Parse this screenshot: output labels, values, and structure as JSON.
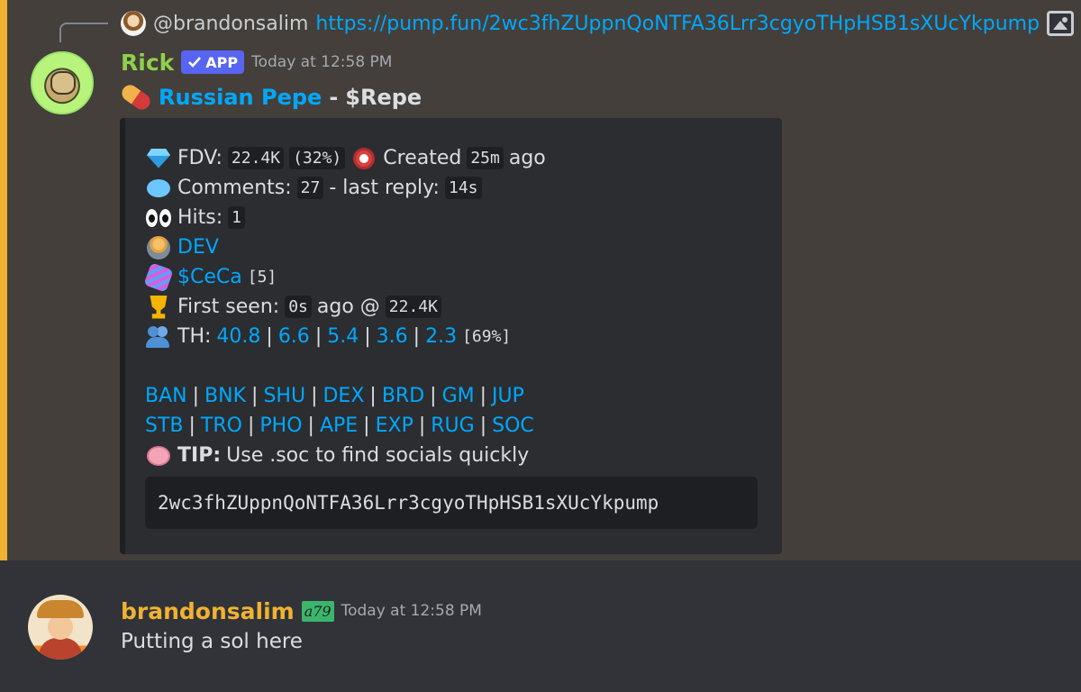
{
  "reply": {
    "username": "@brandonsalim",
    "link": "https://pump.fun/2wc3fhZUppnQoNTFA36Lrr3cgyoTHpHSB1sXUcYkpump",
    "attachment_icon": "image-icon"
  },
  "message1": {
    "author": "Rick",
    "badge": "APP",
    "badge_icon": "checkmark-icon",
    "timestamp": "Today at 12:58 PM",
    "title_icon": "pill-icon",
    "title_link": "Russian Pepe",
    "title_sep": " - ",
    "title_ticker": "$Repe"
  },
  "embed": {
    "fdv_label": "FDV:",
    "fdv_value": "22.4K",
    "fdv_pct": "(32%)",
    "created_label": "Created",
    "created_value": "25m",
    "created_suffix": "ago",
    "comments_label": "Comments:",
    "comments_value": "27",
    "last_reply_label": "- last reply:",
    "last_reply_value": "14s",
    "hits_label": "Hits:",
    "hits_value": "1",
    "dev_link": "DEV",
    "ceca_link": "$CeCa",
    "ceca_count": "[5]",
    "first_seen_label": "First seen:",
    "first_seen_value": "0s",
    "first_seen_mid": "ago @",
    "first_seen_mcap": "22.4K",
    "th_label": "TH:",
    "th_values": [
      "40.8",
      "6.6",
      "5.4",
      "3.6",
      "2.3"
    ],
    "th_pct": "[69%]",
    "links_row1": [
      "BAN",
      "BNK",
      "SHU",
      "DEX",
      "BRD",
      "GM",
      "JUP"
    ],
    "links_row2": [
      "STB",
      "TRO",
      "PHO",
      "APE",
      "EXP",
      "RUG",
      "SOC"
    ],
    "tip_label": "TIP:",
    "tip_text": "Use .soc to find socials quickly",
    "address": "2wc3fhZUppnQoNTFA36Lrr3cgyoTHpHSB1sXUcYkpump"
  },
  "message2": {
    "author": "brandonsalim",
    "tag": "a79",
    "timestamp": "Today at 12:58 PM",
    "text": "Putting a sol here"
  },
  "colors": {
    "link": "#00a8fc",
    "rick_name": "#8fd04b",
    "brandon_name": "#f0b232",
    "app_badge": "#5865f2",
    "highlight_bar": "#f0b232"
  }
}
